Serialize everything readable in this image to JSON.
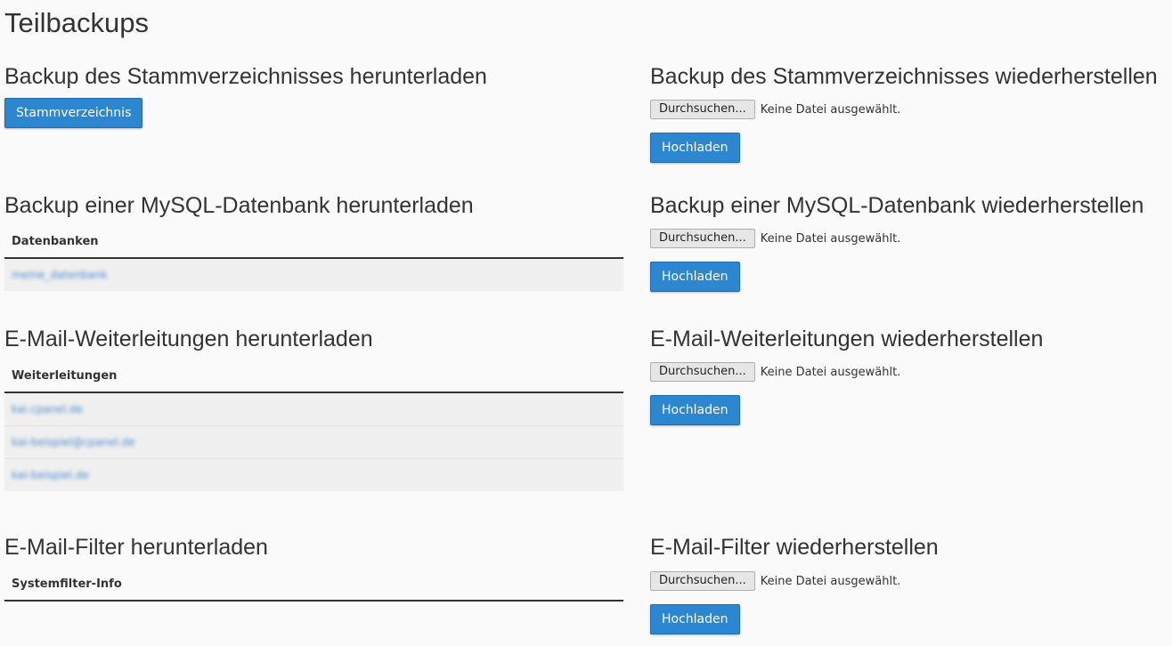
{
  "page": {
    "title": "Teilbackups"
  },
  "home": {
    "download_title": "Backup des Stammverzeichnisses herunterladen",
    "download_button": "Stammverzeichnis",
    "restore_title": "Backup des Stammverzeichnisses wiederherstellen"
  },
  "mysql": {
    "download_title": "Backup einer MySQL-Datenbank herunterladen",
    "column_header": "Datenbanken",
    "rows": [
      "meine_datenbank"
    ],
    "restore_title": "Backup einer MySQL-Datenbank wiederherstellen"
  },
  "forwarders": {
    "download_title": "E-Mail-Weiterleitungen herunterladen",
    "column_header": "Weiterleitungen",
    "rows": [
      "kai.cpanel.de",
      "kai-beispiel@cpanel.de",
      "kai-beispiel.de"
    ],
    "restore_title": "E-Mail-Weiterleitungen wiederherstellen"
  },
  "filters": {
    "download_title": "E-Mail-Filter herunterladen",
    "column_header": "Systemfilter-Info",
    "restore_title": "E-Mail-Filter wiederherstellen"
  },
  "file_input": {
    "browse_label": "Durchsuchen...",
    "status_text": "Keine Datei ausgewählt."
  },
  "upload_button": "Hochladen",
  "colors": {
    "primary": "#2d87d0"
  }
}
